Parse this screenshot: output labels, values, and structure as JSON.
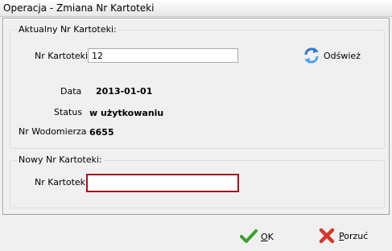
{
  "window": {
    "title": "Operacja - Zmiana Nr Kartoteki"
  },
  "current": {
    "legend": "Aktualny Nr Kartoteki:",
    "kartoteka_label": "Nr Kartoteki",
    "kartoteka_value": "12",
    "refresh_label": "Odśwież",
    "data_label": "Data",
    "data_value": "2013-01-01",
    "status_label": "Status",
    "status_value": "w użytkowaniu",
    "wodomierz_label": "Nr Wodomierza",
    "wodomierz_value": "6655"
  },
  "new": {
    "legend": "Nowy Nr Kartoteki:",
    "kartoteka_label": "Nr Kartoteki",
    "kartoteka_value": ""
  },
  "footer": {
    "ok_prefix": "O",
    "ok_rest": "K",
    "cancel_prefix": "P",
    "cancel_rest": "orzuć"
  },
  "icons": [
    "refresh-icon",
    "checkmark-icon",
    "cross-icon"
  ],
  "colors": {
    "active_border": "#a1131e",
    "check_green": "#3aa12b",
    "cross_red": "#d9362a",
    "refresh_blue": "#2b79d6"
  }
}
